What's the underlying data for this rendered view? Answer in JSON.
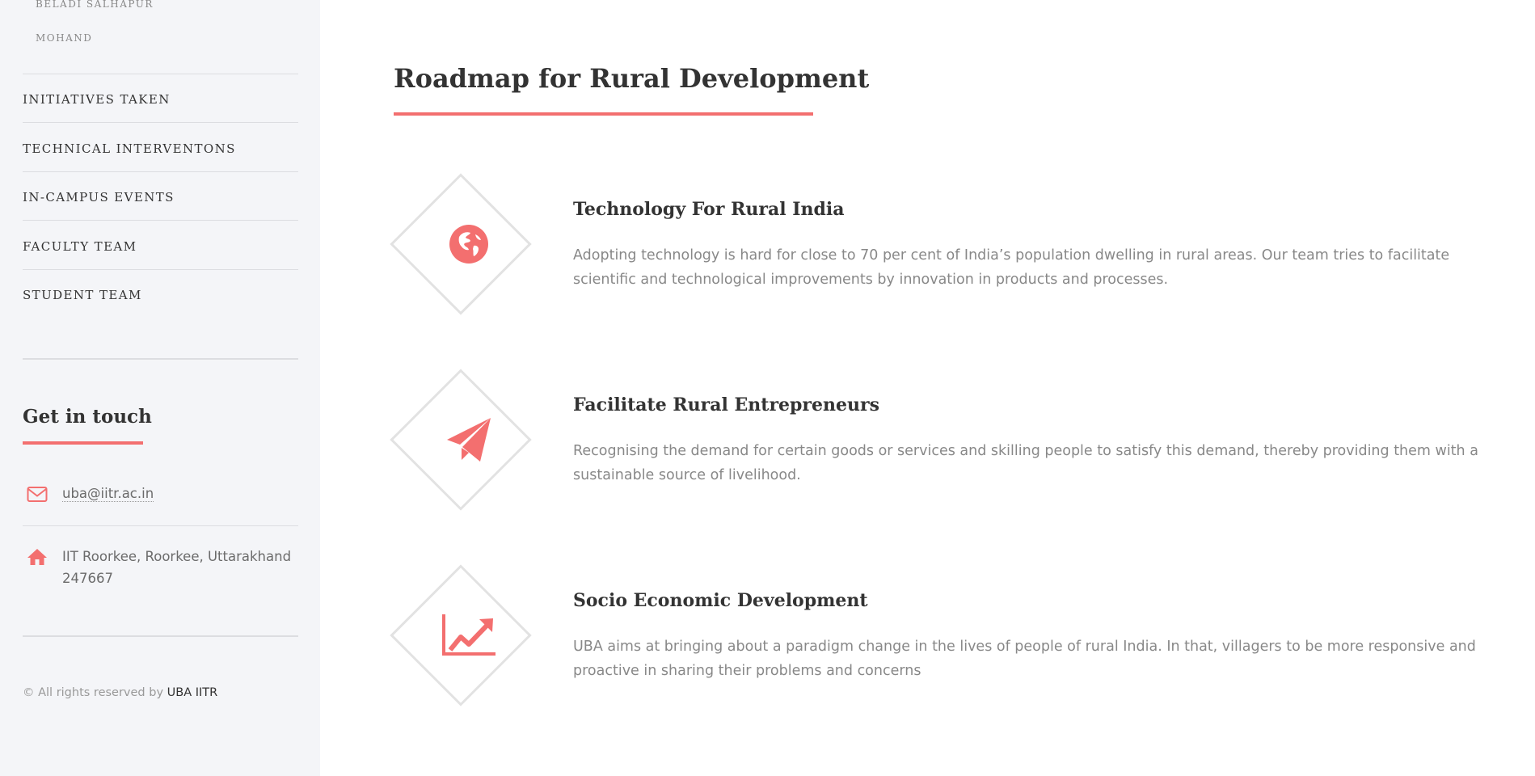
{
  "sidebar": {
    "sub_items": [
      "BELADI SALHAPUR",
      "MOHAND"
    ],
    "nav_items": [
      {
        "label": "INITIATIVES TAKEN"
      },
      {
        "label": "TECHNICAL INTERVENTONS"
      },
      {
        "label": "IN-CAMPUS EVENTS"
      },
      {
        "label": "FACULTY TEAM"
      },
      {
        "label": "STUDENT TEAM"
      }
    ],
    "get_in_touch": {
      "title": "Get in touch",
      "email": "uba@iitr.ac.in",
      "address_line1": "IIT Roorkee, Roorkee, Uttarakhand",
      "address_line2": "247667"
    },
    "copyright": {
      "prefix": "© All rights reserved by",
      "brand": "UBA IITR"
    }
  },
  "main": {
    "title": "Roadmap for Rural Development",
    "features": [
      {
        "icon": "globe-icon",
        "title": "Technology For Rural India",
        "description": "Adopting technology is hard for close to 70 per cent of India’s population dwelling in rural areas. Our team tries to facilitate scientific and technological improvements by innovation in products and processes."
      },
      {
        "icon": "paper-plane-icon",
        "title": "Facilitate Rural Entrepreneurs",
        "description": "Recognising the demand for certain goods or services and skilling people to satisfy this demand, thereby providing them with a sustainable source of livelihood."
      },
      {
        "icon": "trend-chart-icon",
        "title": "Socio Economic Development",
        "description": "UBA aims at bringing about a paradigm change in the lives of people of rural India. In that, villagers to be more responsive and proactive in sharing their problems and concerns"
      }
    ]
  },
  "colors": {
    "accent": "#f36f6f",
    "sidebar_bg": "#f4f5f8",
    "heading": "#333333",
    "body_text": "#888888"
  }
}
